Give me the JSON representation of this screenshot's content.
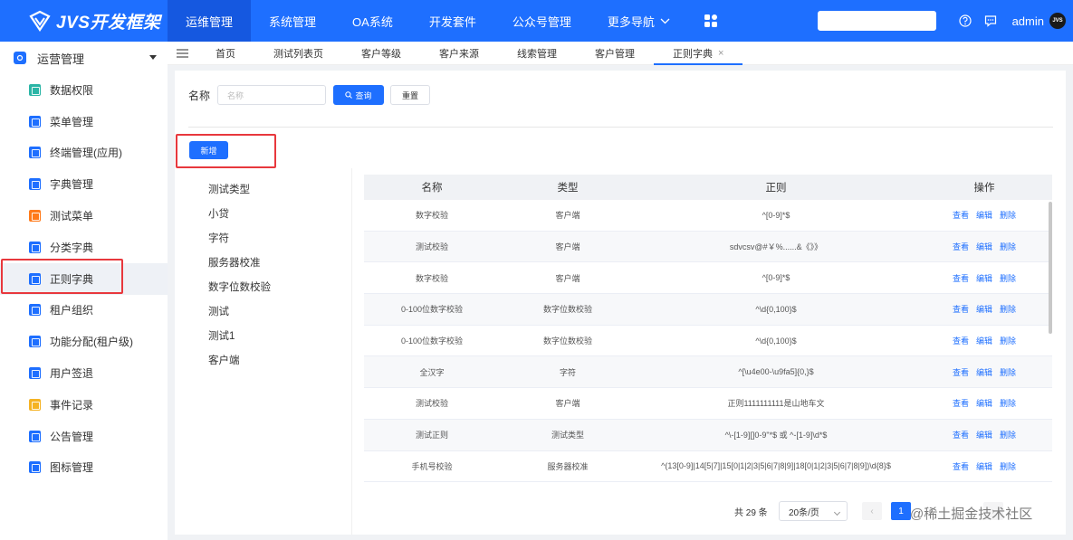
{
  "header": {
    "logo_text": "JVS开发框架",
    "nav": [
      {
        "label": "运维管理",
        "active": true
      },
      {
        "label": "系统管理"
      },
      {
        "label": "OA系统"
      },
      {
        "label": "开发套件"
      },
      {
        "label": "公众号管理"
      },
      {
        "label": "更多导航"
      }
    ],
    "user": "admin",
    "avatar_text": "JVS"
  },
  "sidebar": {
    "group": "运营管理",
    "items": [
      {
        "label": "数据权限",
        "color": "#2bb5a6"
      },
      {
        "label": "菜单管理",
        "color": "#1e6fff"
      },
      {
        "label": "终端管理(应用)",
        "color": "#1e6fff"
      },
      {
        "label": "字典管理",
        "color": "#1e6fff"
      },
      {
        "label": "测试菜单",
        "color": "#ff7a1a"
      },
      {
        "label": "分类字典",
        "color": "#1e6fff"
      },
      {
        "label": "正则字典",
        "color": "#1e6fff",
        "active": true
      },
      {
        "label": "租户组织",
        "color": "#1e6fff"
      },
      {
        "label": "功能分配(租户级)",
        "color": "#1e6fff"
      },
      {
        "label": "用户签退",
        "color": "#1e6fff"
      },
      {
        "label": "事件记录",
        "color": "#f5b324"
      },
      {
        "label": "公告管理",
        "color": "#1e6fff"
      },
      {
        "label": "图标管理",
        "color": "#1e6fff"
      }
    ]
  },
  "tabs": [
    {
      "label": "首页"
    },
    {
      "label": "测试列表页"
    },
    {
      "label": "客户等级"
    },
    {
      "label": "客户来源"
    },
    {
      "label": "线索管理"
    },
    {
      "label": "客户管理"
    },
    {
      "label": "正则字典",
      "active": true,
      "close": "×"
    }
  ],
  "search": {
    "label": "名称",
    "placeholder": "名称",
    "query_label": "查询",
    "reset_label": "重置"
  },
  "add_label": "新增",
  "types": [
    "测试类型",
    "小贷",
    "字符",
    "服务器校准",
    "数字位数校验",
    "测试",
    "测试1",
    "客户端"
  ],
  "table": {
    "columns": [
      "名称",
      "类型",
      "正则",
      "操作"
    ],
    "actions": [
      "查看",
      "编辑",
      "删除"
    ],
    "rows": [
      {
        "name": "数字校验",
        "type": "客户端",
        "regex": "^[0-9]*$"
      },
      {
        "name": "测试校验",
        "type": "客户端",
        "regex": "sdvcsv@#￥%......&《》》"
      },
      {
        "name": "数字校验",
        "type": "客户端",
        "regex": "^[0-9]*$"
      },
      {
        "name": "0-100位数字校验",
        "type": "数字位数校验",
        "regex": "^\\d{0,100}$"
      },
      {
        "name": "0-100位数字校验",
        "type": "数字位数校验",
        "regex": "^\\d{0,100}$"
      },
      {
        "name": "全汉字",
        "type": "字符",
        "regex": "^[\\u4e00-\\u9fa5]{0,}$"
      },
      {
        "name": "测试校验",
        "type": "客户端",
        "regex": "正则1111111111是山地车文"
      },
      {
        "name": "测试正则",
        "type": "测试类型",
        "regex": "^\\-[1-9][]0-9\"*$ 或 ^-[1-9]\\d*$"
      },
      {
        "name": "手机号校验",
        "type": "服务器校准",
        "regex": "^(13[0-9]|14[5|7]|15[0|1|2|3|5|6|7|8|9]|18[0|1|2|3|5|6|7|8|9])\\d{8}$"
      }
    ]
  },
  "pagination": {
    "total": "共 29 条",
    "page_size": "20条/页",
    "current": "1",
    "prev": "‹",
    "next": "›"
  },
  "watermark": "@稀土掘金技术社区"
}
